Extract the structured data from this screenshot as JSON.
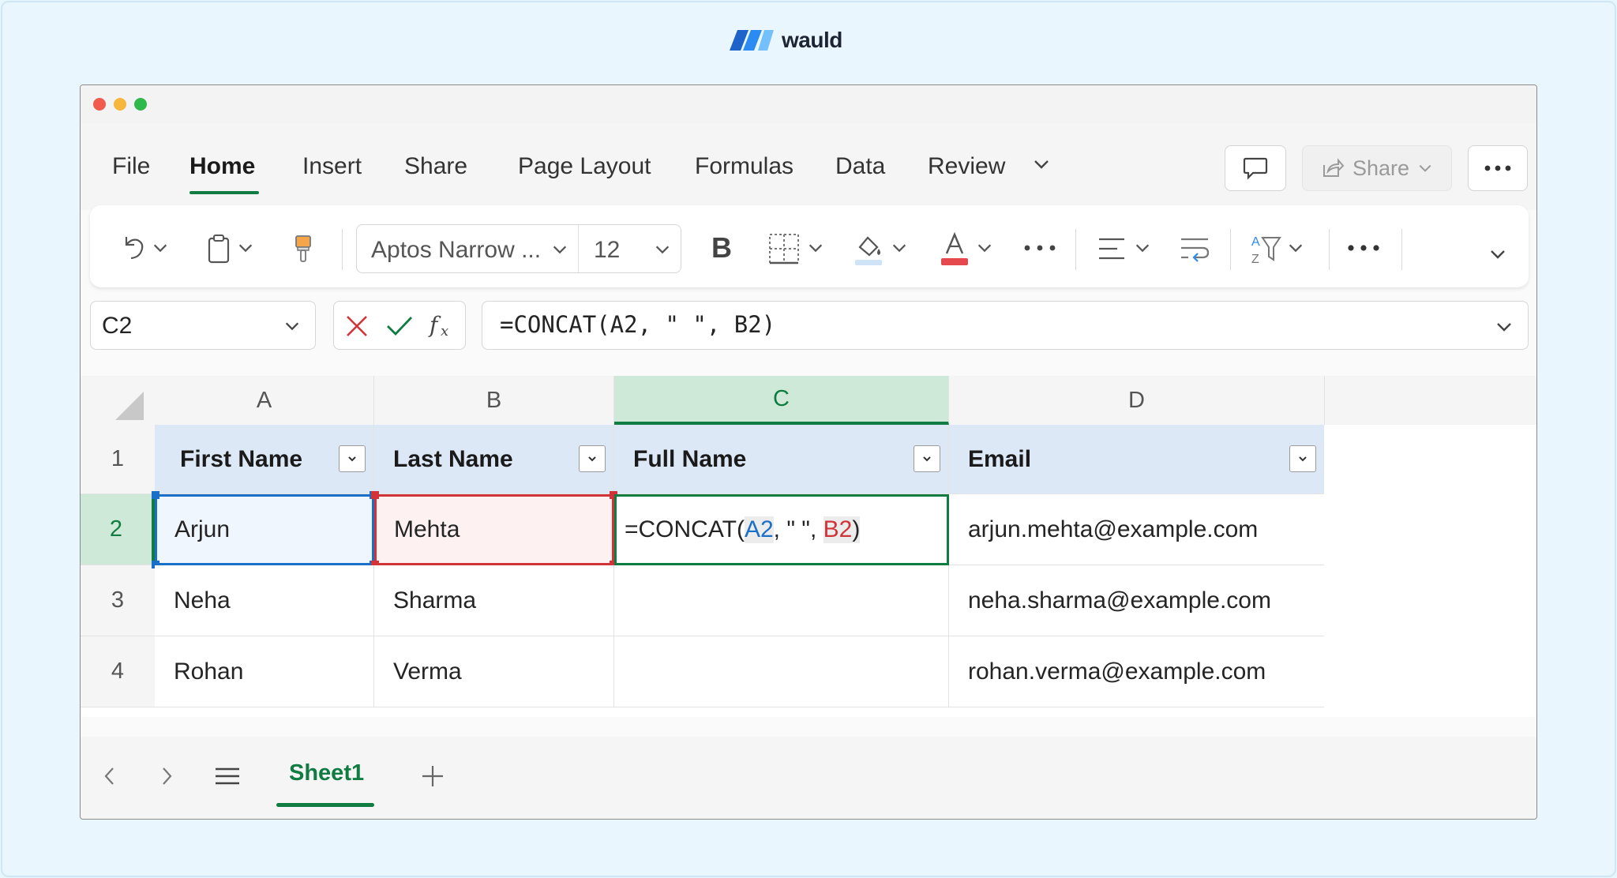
{
  "brand": {
    "name": "wauld"
  },
  "menu": {
    "tabs": [
      "File",
      "Home",
      "Insert",
      "Share",
      "Page Layout",
      "Formulas",
      "Data",
      "Review"
    ],
    "active_tab": "Home",
    "share_label": "Share"
  },
  "ribbon": {
    "font_name": "Aptos Narrow ...",
    "font_size": "12",
    "bold_label": "B"
  },
  "formula_bar": {
    "name_box": "C2",
    "formula": "=CONCAT(A2, \" \", B2)"
  },
  "sheet": {
    "columns": [
      "A",
      "B",
      "C",
      "D"
    ],
    "selected_column": "C",
    "rows": [
      "1",
      "2",
      "3",
      "4"
    ],
    "selected_row": "2",
    "headers": [
      "First Name",
      "Last Name",
      "Full Name",
      "Email"
    ],
    "data": [
      [
        "Arjun",
        "Mehta",
        "",
        "arjun.mehta@example.com"
      ],
      [
        "Neha",
        "Sharma",
        "",
        "neha.sharma@example.com"
      ],
      [
        "Rohan",
        "Verma",
        "",
        "rohan.verma@example.com"
      ]
    ],
    "active_cell_formula": {
      "prefix": "=CONCAT(",
      "ref_a": "A2",
      "middle": ", \" \", ",
      "ref_b": "B2",
      "suffix": ")"
    }
  },
  "sheet_tabs": {
    "active": "Sheet1"
  },
  "colors": {
    "accent_green": "#107c41",
    "ref_blue": "#1a6fc9",
    "ref_red": "#d13438",
    "header_fill": "#dce8f5",
    "page_background": "#eaf6fd"
  }
}
